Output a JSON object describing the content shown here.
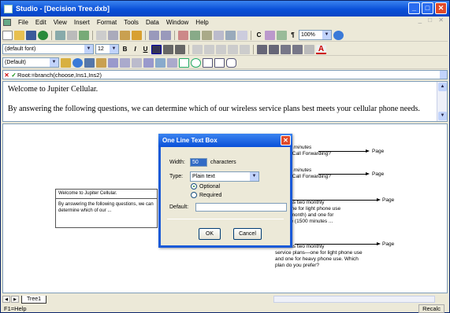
{
  "window": {
    "title": "Studio - [Decision Tree.dxb]"
  },
  "menu": [
    "File",
    "Edit",
    "View",
    "Insert",
    "Format",
    "Tools",
    "Data",
    "Window",
    "Help"
  ],
  "menu_underline": [
    "F",
    "E",
    "V",
    "I",
    "o",
    "T",
    "D",
    "W",
    "H"
  ],
  "toolbar2": {
    "font": "(default font)",
    "size": "12",
    "zoom": "100%",
    "bold": "B",
    "italic": "I",
    "underline": "U",
    "pilcrow": "¶",
    "c_label": "C"
  },
  "toolbar3": {
    "style": "(Default)"
  },
  "formula": {
    "text": "Root:=branch(choose,Ins1,Ins2)"
  },
  "textpane": {
    "line1": "Welcome to Jupiter Cellular.",
    "line2": "By answering the following questions, we can determine which of our wireless service plans best meets your cellular phone needs."
  },
  "node": {
    "title": "Welcome to Jupiter Cellular.",
    "body": "By answering the following questions, we can determine which of our ..."
  },
  "branches": [
    {
      "lines": [
        "than 30 minutes",
        "u need Call Forwarding?"
      ],
      "page": "Page"
    },
    {
      "lines": [
        "than 30 minutes",
        "u need Call Forwarding?"
      ],
      "page": "Page"
    },
    {
      "lines": [
        "e",
        "llular has two monthly",
        "ans—one for light phone use",
        "ss per month) and one for",
        "one use (1500 minutes ..."
      ],
      "page": "Page"
    },
    {
      "lines": [
        "hones",
        "llular has two monthly",
        "service plans—one for light phone use",
        "and one for heavy phone use. Which",
        "plan do you prefer?"
      ],
      "page": "Page"
    }
  ],
  "dialog": {
    "title": "One Line Text Box",
    "width_label": "Width:",
    "width_value": "50",
    "characters": "characters",
    "type_label": "Type:",
    "type_value": "Plain text",
    "optional": "Optional",
    "required": "Required",
    "default_label": "Default:",
    "default_value": "",
    "ok": "OK",
    "cancel": "Cancel"
  },
  "tabs": {
    "tree": "Tree1"
  },
  "status": {
    "left": "F1=Help",
    "right": "Recalc"
  },
  "colors": {
    "title_blue": "#0a50d8",
    "chrome": "#ece9d8",
    "close_red": "#e04a2a"
  }
}
